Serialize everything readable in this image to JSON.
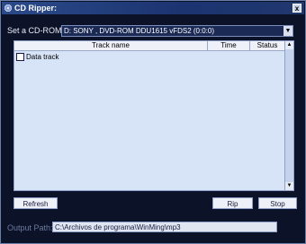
{
  "window": {
    "title": "CD Ripper:",
    "close_glyph": "x"
  },
  "cdrom": {
    "label": "Set a CD-ROM:",
    "selected": "D: SONY    , DVD-ROM DDU1615  vFDS2 (0:0:0)"
  },
  "tracks": {
    "columns": [
      "Track name",
      "Time",
      "Status"
    ],
    "rows": [
      {
        "name": "Data track",
        "time": "",
        "status": ""
      }
    ]
  },
  "buttons": {
    "refresh": "Refresh",
    "rip": "Rip",
    "stop": "Stop"
  },
  "output": {
    "label": "Output Path:",
    "value": "C:\\Archivos de programa\\WinMing\\mp3"
  }
}
